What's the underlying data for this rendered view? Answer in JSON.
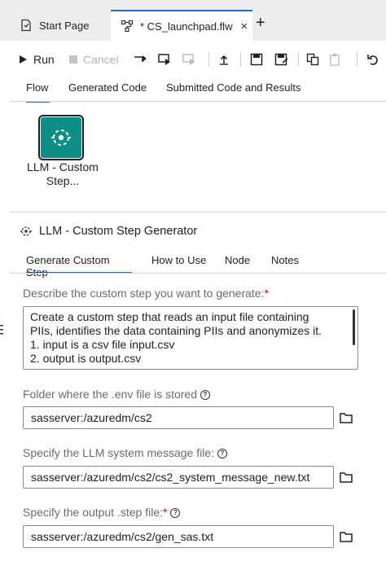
{
  "tabs": {
    "start_page": "Start Page",
    "flow_file": "* CS_launchpad.flw",
    "close_symbol": "×",
    "new_tab_symbol": "+"
  },
  "toolbar": {
    "run": "Run",
    "cancel": "Cancel"
  },
  "views": [
    "Flow",
    "Generated Code",
    "Submitted Code and Results"
  ],
  "canvas": {
    "node_label_line1": "LLM - Custom",
    "node_label_line2": "Step..."
  },
  "panel": {
    "title": "LLM - Custom Step Generator",
    "tabs": [
      "Generate Custom Step",
      "How to Use",
      "Node",
      "Notes"
    ]
  },
  "form": {
    "describe_label": "Describe the custom step you want to generate:",
    "describe_lines": [
      "Create a custom step that reads an input file containing",
      "PIIs, identifies the data containing PIIs and anonymizes it.",
      "1. input is a csv file input.csv",
      "2. output is output.csv"
    ],
    "env_label": "Folder where the .env file is stored",
    "env_value": "sasserver:/azuredm/cs2",
    "sysmsg_label": "Specify the LLM system message file:",
    "sysmsg_value": "sasserver:/azuredm/cs2/cs2_system_message_new.txt",
    "output_label": "Specify the output .step file:",
    "output_value": "sasserver:/azuredm/cs2/gen_sas.txt",
    "required_mark": "*",
    "help_mark": "?"
  },
  "colors": {
    "accent": "#1b6fc9",
    "node": "#0d8f85",
    "required": "#c8102e",
    "label": "#6b6b6b"
  }
}
